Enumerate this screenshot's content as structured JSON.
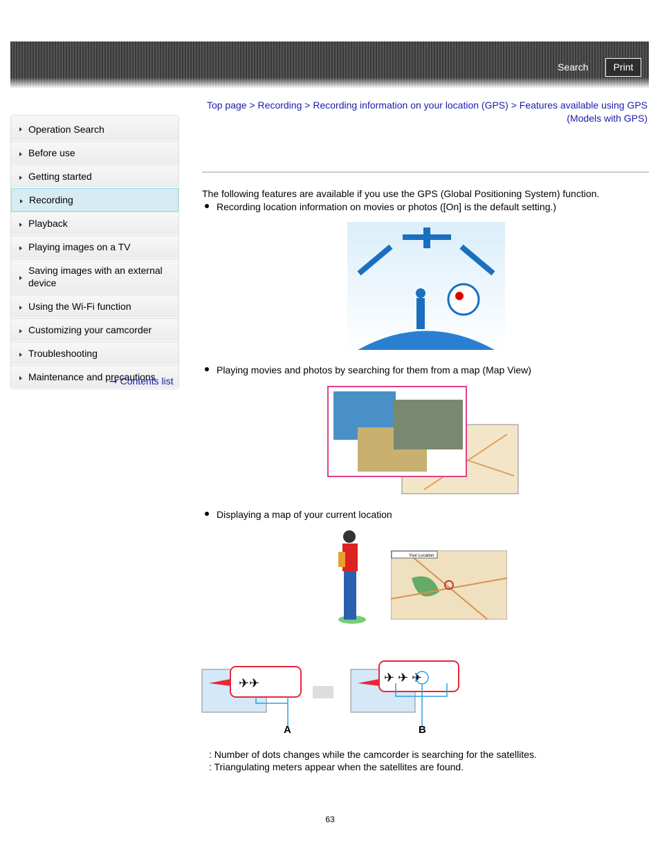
{
  "header": {
    "search": "Search",
    "print": "Print"
  },
  "breadcrumb": [
    "Top page",
    "Recording",
    "Recording information on your location (GPS)",
    "Features available using GPS (Models with GPS)"
  ],
  "sidebar": {
    "items": [
      "Operation Search",
      "Before use",
      "Getting started",
      "Recording",
      "Playback",
      "Playing images on a TV",
      "Saving images with an external device",
      "Using the Wi-Fi function",
      "Customizing your camcorder",
      "Troubleshooting",
      "Maintenance and precautions"
    ],
    "selected": "Recording",
    "contents_link": "Contents list"
  },
  "main": {
    "intro": "The following features are available if you use the GPS (Global Positioning System) function.",
    "bullets": [
      "Recording location information on movies or photos ([On] is the default setting.)",
      "Playing movies and photos by searching for them from a map (Map View)",
      "Displaying a map of your current location"
    ],
    "figure_labels": {
      "a": "A",
      "b": "B",
      "your_location": "Your Location"
    },
    "notes": [
      ": Number of dots changes while the camcorder is searching for the satellites.",
      ": Triangulating meters appear when the satellites are found."
    ],
    "page_number": "63"
  },
  "colors": {
    "link": "#1a1ab0",
    "selected_bg": "#d6ecf2",
    "callout": "#e8263a",
    "leader": "#2aa0e0"
  }
}
